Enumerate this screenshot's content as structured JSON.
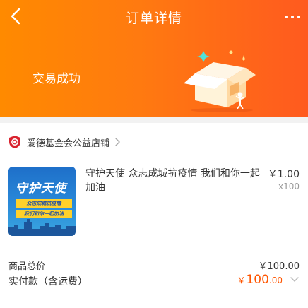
{
  "header": {
    "title": "订单详情",
    "status": "交易成功",
    "back_icon": "chevron-left-icon",
    "more_icon": "more-horizontal-icon",
    "background_gradient": [
      "#ff8a00",
      "#ff5a1f"
    ]
  },
  "shop": {
    "name": "爱德基金会公益店铺",
    "logo_icon": "shield-logo-icon",
    "logo_color": "#d9232f"
  },
  "product": {
    "title": "守护天使 众志成城抗疫情 我们和你一起加油",
    "price": "￥1.00",
    "quantity": "x100",
    "image": {
      "title": "守护天使",
      "badge1": "众志成城抗疫情",
      "badge2": "我们和你一起加油"
    }
  },
  "summary": {
    "total_label": "商品总价",
    "total_value": "￥100.00",
    "paid_label": "实付款（含运费）",
    "paid_currency": "￥",
    "paid_integer": "100",
    "paid_decimal": ".00",
    "accent_color": "#ff5500"
  }
}
